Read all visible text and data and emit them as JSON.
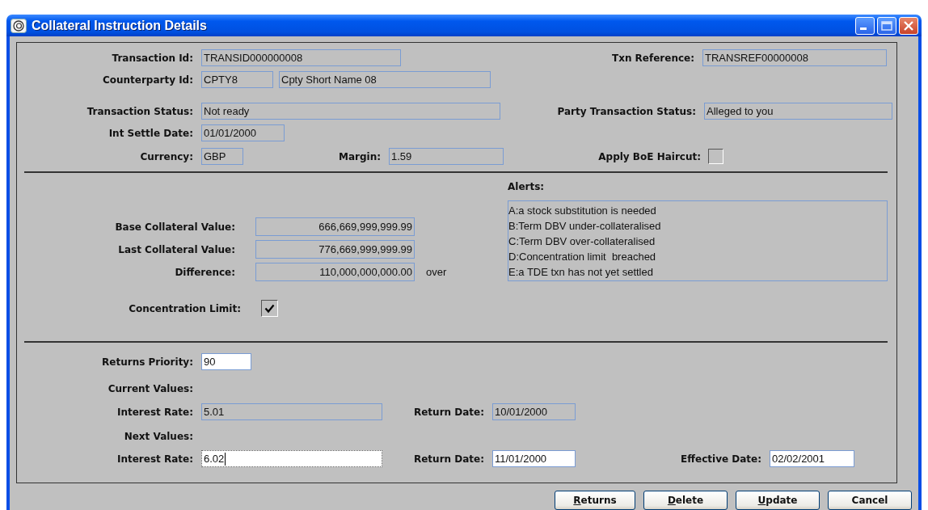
{
  "window": {
    "title": "Collateral Instruction Details"
  },
  "top": {
    "rows": [
      {
        "items": [
          {
            "kind": "field",
            "label": "Transaction Id:",
            "value": "TRANSID000000008",
            "editable": false,
            "focused": false
          },
          {
            "kind": "field",
            "label": "Txn Reference:",
            "value": "TRANSREF00000008",
            "editable": false,
            "focused": false
          }
        ]
      },
      {
        "items": [
          {
            "kind": "field",
            "label": "Counterparty Id:",
            "value": "CPTY8",
            "editable": false,
            "focused": false
          },
          {
            "kind": "field",
            "value": "Cpty Short Name 08",
            "editable": false,
            "focused": false
          }
        ]
      },
      {
        "items": [
          {
            "kind": "field",
            "label": "Transaction Status:",
            "value": "Not ready",
            "editable": false,
            "focused": false
          },
          {
            "kind": "field",
            "label": "Party Transaction Status:",
            "value": "Alleged to you",
            "editable": false,
            "focused": false
          }
        ]
      },
      {
        "items": [
          {
            "kind": "field",
            "label": "Int Settle Date:",
            "value": "01/01/2000",
            "editable": false,
            "focused": false
          }
        ]
      },
      {
        "items": [
          {
            "kind": "field",
            "label": "Currency:",
            "value": "GBP",
            "editable": false,
            "focused": false
          },
          {
            "kind": "field",
            "label": "Margin:",
            "value": "1.59",
            "editable": false,
            "focused": false
          },
          {
            "kind": "checkbox",
            "label": "Apply BoE Haircut:",
            "checked": false
          }
        ]
      }
    ]
  },
  "collateral": {
    "values": [
      {
        "label": "Base Collateral Value:",
        "value": "666,669,999,999.99",
        "editable": false,
        "focused": false
      },
      {
        "label": "Last Collateral Value:",
        "value": "776,669,999,999.99",
        "editable": false,
        "focused": false
      },
      {
        "label": "Difference:",
        "value": "110,000,000,000.00",
        "note": "over",
        "editable": false,
        "focused": false
      }
    ],
    "concentration_limit": {
      "label": "Concentration Limit:",
      "checked": true
    },
    "alerts": {
      "label": "Alerts:",
      "items": [
        "A:a stock substitution is needed",
        "B:Term DBV under-collateralised",
        "C:Term DBV over-collateralised",
        "D:Concentration limit  breached",
        "E:a TDE txn has not yet settled"
      ]
    }
  },
  "returns": {
    "rows": [
      {
        "items": [
          {
            "kind": "field",
            "label": "Returns Priority:",
            "value": "90",
            "editable": true,
            "focused": false
          }
        ]
      },
      {
        "items": [
          {
            "kind": "heading",
            "label": "Current Values:"
          }
        ]
      },
      {
        "items": [
          {
            "kind": "field",
            "label": "Interest Rate:",
            "value": "5.01",
            "editable": false,
            "focused": false
          },
          {
            "kind": "field",
            "label": "Return Date:",
            "value": "10/01/2000",
            "editable": false,
            "focused": false
          }
        ]
      },
      {
        "items": [
          {
            "kind": "heading",
            "label": "Next Values:"
          }
        ]
      },
      {
        "items": [
          {
            "kind": "field",
            "label": "Interest Rate:",
            "value": "6.02",
            "editable": true,
            "focused": true
          },
          {
            "kind": "field",
            "label": "Return Date:",
            "value": "11/01/2000",
            "editable": true,
            "focused": false
          },
          {
            "kind": "field",
            "label": "Effective Date:",
            "value": "02/02/2001",
            "editable": true,
            "focused": false
          }
        ]
      }
    ]
  },
  "buttons": [
    {
      "label": "Returns",
      "underline_first": true
    },
    {
      "label": "Delete",
      "underline_first": true
    },
    {
      "label": "Update",
      "underline_first": true
    },
    {
      "label": "Cancel",
      "underline_first": false
    }
  ]
}
